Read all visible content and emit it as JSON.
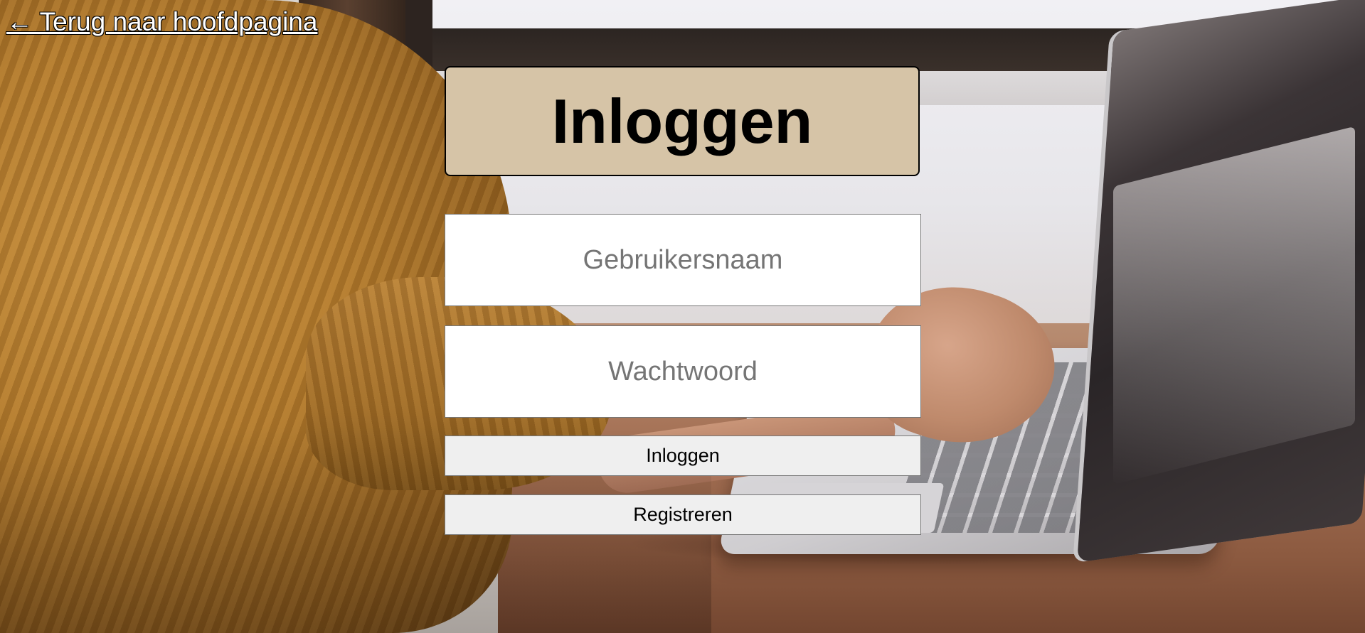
{
  "back_link": {
    "label": "← Terug naar hoofdpagina"
  },
  "login_form": {
    "title": "Inloggen",
    "username_placeholder": "Gebruikersnaam",
    "password_placeholder": "Wachtwoord",
    "login_button": "Inloggen",
    "register_button": "Registreren"
  },
  "colors": {
    "title_background": "#d6c4a7",
    "button_background": "#efefef",
    "input_background": "#ffffff"
  }
}
